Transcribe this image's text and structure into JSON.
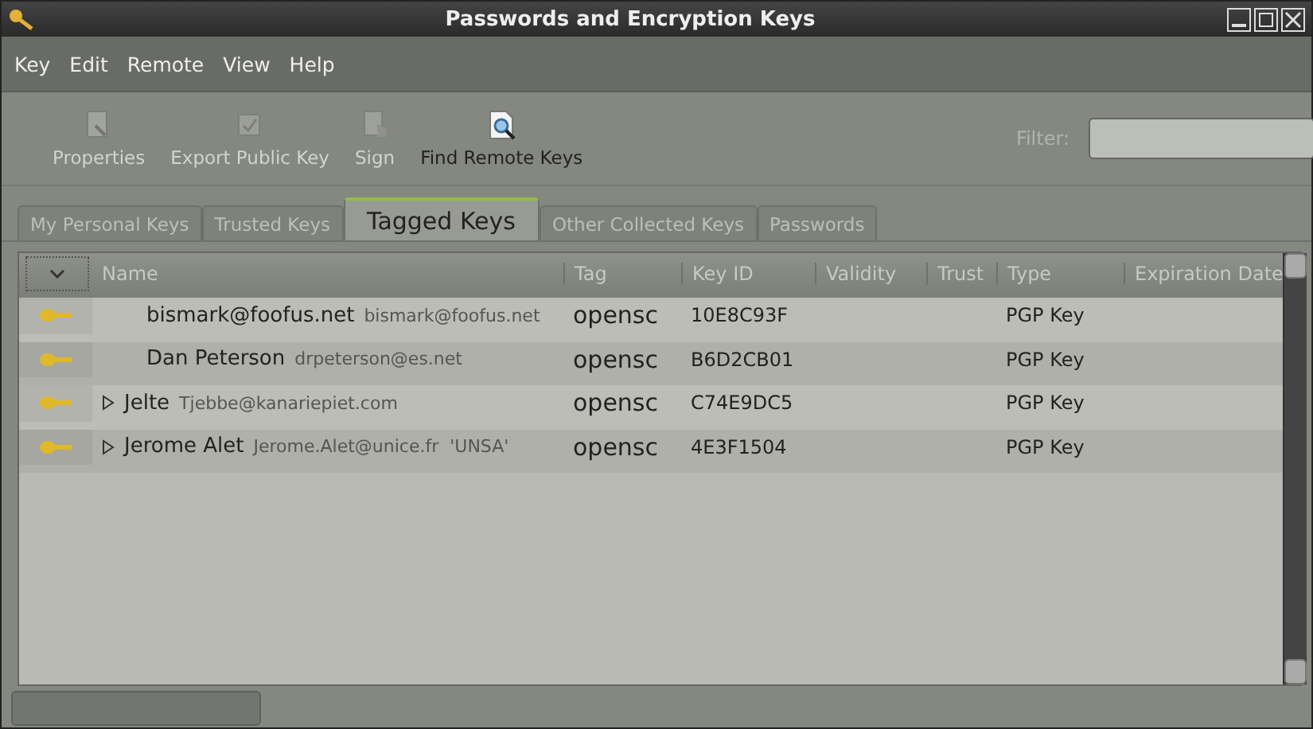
{
  "window": {
    "title": "Passwords and Encryption Keys"
  },
  "menu": [
    "Key",
    "Edit",
    "Remote",
    "View",
    "Help"
  ],
  "toolbar": [
    {
      "label": "Properties",
      "kind": "properties",
      "disabled": true
    },
    {
      "label": "Export Public Key",
      "kind": "export",
      "disabled": true
    },
    {
      "label": "Sign",
      "kind": "sign",
      "disabled": true
    },
    {
      "label": "Find Remote Keys",
      "kind": "find",
      "disabled": false
    }
  ],
  "filter": {
    "label": "Filter:"
  },
  "tabs": [
    {
      "label": "My Personal Keys",
      "selected": false
    },
    {
      "label": "Trusted Keys",
      "selected": false
    },
    {
      "label": "Tagged Keys",
      "selected": true
    },
    {
      "label": "Other Collected Keys",
      "selected": false
    },
    {
      "label": "Passwords",
      "selected": false
    }
  ],
  "table": {
    "columns": [
      "Name",
      "Tag",
      "Key ID",
      "Validity",
      "Trust",
      "Type",
      "Expiration Date"
    ],
    "rows": [
      {
        "name": "bismark@foofus.net",
        "email": "bismark@foofus.net",
        "tag": "opensc",
        "key_id": "10E8C93F",
        "type": "PGP Key",
        "expandable": false
      },
      {
        "name": "Dan Peterson",
        "email": "drpeterson@es.net",
        "tag": "opensc",
        "key_id": "B6D2CB01",
        "type": "PGP Key",
        "expandable": false
      },
      {
        "name": "Jelte",
        "email": "Tjebbe@kanariepiet.com",
        "tag": "opensc",
        "key_id": "C74E9DC5",
        "type": "PGP Key",
        "expandable": true
      },
      {
        "name": "Jerome Alet",
        "email": "Jerome.Alet@unice.fr  'UNSA'",
        "tag": "opensc",
        "key_id": "4E3F1504",
        "type": "PGP Key",
        "expandable": true
      }
    ]
  }
}
